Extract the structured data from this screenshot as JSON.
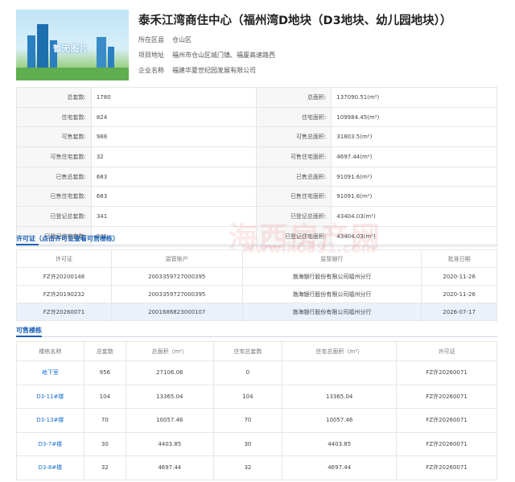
{
  "project": {
    "title": "泰禾江湾商住中心（福州湾D地块（D3地块、幼儿园地块））",
    "thumb_caption": "暂无图片",
    "meta": [
      {
        "key": "所在区县",
        "value": "仓山区"
      },
      {
        "key": "项目地址",
        "value": "福州市仓山区城门镇、福厦高速路西"
      },
      {
        "key": "企业名称",
        "value": "福建华夏世纪园发展有限公司"
      }
    ]
  },
  "info_rows": [
    {
      "l1": "总套数:",
      "v1": "1780",
      "l2": "总面积:",
      "v2": "137090.51(m²)"
    },
    {
      "l1": "住宅套数:",
      "v1": "824",
      "l2": "住宅面积:",
      "v2": "109984.45(m²)"
    },
    {
      "l1": "可售套数:",
      "v1": "988",
      "l2": "可售总面积:",
      "v2": "31803.5(m²)"
    },
    {
      "l1": "可售住宅套数:",
      "v1": "32",
      "l2": "可售住宅面积:",
      "v2": "4697.44(m²)"
    },
    {
      "l1": "已售总套数:",
      "v1": "683",
      "l2": "已售总面积:",
      "v2": "91091.6(m²)"
    },
    {
      "l1": "已售住宅套数:",
      "v1": "683",
      "l2": "已售住宅面积:",
      "v2": "91091.6(m²)"
    },
    {
      "l1": "已登记总套数:",
      "v1": "341",
      "l2": "已登记总面积:",
      "v2": "43404.03(m²)"
    },
    {
      "l1": "已登记住宅套数:",
      "v1": "341",
      "l2": "已登记住宅面积:",
      "v2": "43404.03(m²)"
    }
  ],
  "permit": {
    "section_title": "许可证（点击许可证查看可售楼栋）",
    "headers": [
      "许可证",
      "监管账户",
      "监管银行",
      "批准日期"
    ],
    "rows": [
      [
        "FZ许20200148",
        "2003359727000395",
        "渤海银行股份有限公司福州分行",
        "2020-11-26"
      ],
      [
        "FZ许20190232",
        "2003359727000395",
        "渤海银行股份有限公司福州分行",
        "2020-11-26"
      ],
      [
        "FZ许20260071",
        "2001686823000107",
        "渤海银行股份有限公司福州分行",
        "2026-07-17"
      ]
    ]
  },
  "buildings": {
    "section_title": "可售楼栋",
    "headers": [
      "楼栋名称",
      "总套数",
      "总面积（m²）",
      "住宅总套数",
      "住宅总面积（m²）",
      "许可证"
    ],
    "rows": [
      [
        "地下室",
        "956",
        "27106.06",
        "0",
        "",
        "FZ许20260071"
      ],
      [
        "D3-11#楼",
        "104",
        "13365.04",
        "104",
        "13365.04",
        "FZ许20260071"
      ],
      [
        "D3-13#楼",
        "70",
        "10057.46",
        "70",
        "10057.46",
        "FZ许20260071"
      ],
      [
        "D3-7#楼",
        "30",
        "4403.85",
        "30",
        "4403.85",
        "FZ许20260071"
      ],
      [
        "D3-8#楼",
        "32",
        "4697.44",
        "32",
        "4697.44",
        "FZ许20260071"
      ]
    ]
  },
  "watermark": {
    "cn": "海西房产网",
    "url": "www.h0591.com"
  }
}
